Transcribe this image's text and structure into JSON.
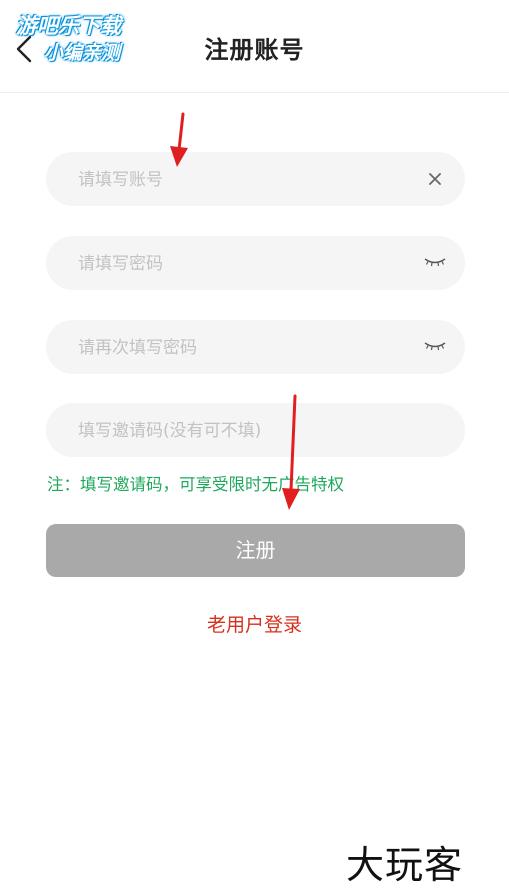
{
  "header": {
    "title": "注册账号",
    "back_icon": "chevron-left-icon"
  },
  "watermark": {
    "line1": "游吧乐下载",
    "line2": "小编亲测"
  },
  "form": {
    "account_placeholder": "请填写账号",
    "password_placeholder": "请填写密码",
    "confirm_password_placeholder": "请再次填写密码",
    "invite_code_placeholder": "填写邀请码(没有可不填)",
    "clear_icon": "close-icon",
    "password_visibility_icon": "eye-closed-icon"
  },
  "note": "注：填写邀请码，可享受限时无广告特权",
  "submit_label": "注册",
  "login_link": "老用户登录",
  "brand": "大玩客",
  "colors": {
    "note": "#1ea85c",
    "login_link": "#d7301e",
    "submit_bg": "#a9a9a9",
    "annotation_arrow": "#e02020"
  }
}
